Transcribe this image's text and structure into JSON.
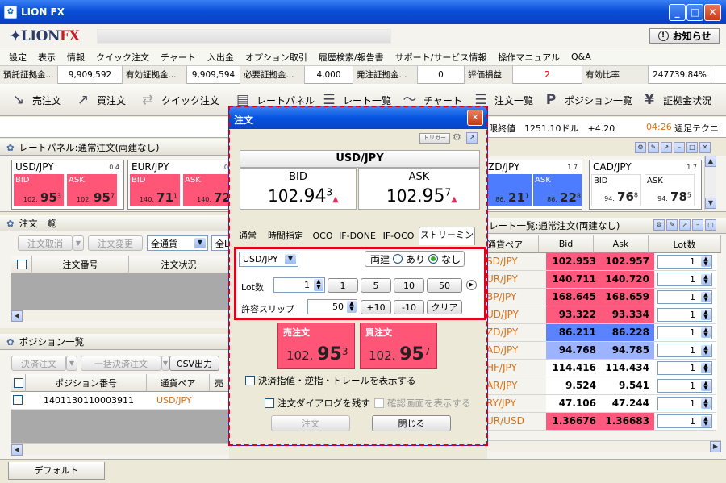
{
  "window": {
    "title": "LION FX",
    "brand_lion": "LION",
    "brand_fx": "FX",
    "notice_label": "お知らせ"
  },
  "menu": [
    "設定",
    "表示",
    "情報",
    "クイック注文",
    "チャート",
    "入出金",
    "オプション取引",
    "履歴検索/報告書",
    "サポート/サービス情報",
    "操作マニュアル",
    "Q&A"
  ],
  "account": [
    {
      "label": "預託証拠金...",
      "value": "9,909,592"
    },
    {
      "label": "有効証拠金...",
      "value": "9,909,594"
    },
    {
      "label": "必要証拠金...",
      "value": "4,000"
    },
    {
      "label": "発注証拠金...",
      "value": "0"
    },
    {
      "label": "評価損益",
      "value": "2"
    },
    {
      "label": "有効比率",
      "value": "247739.84%"
    }
  ],
  "toolbar": [
    "売注文",
    "買注文",
    "クイック注文",
    "レートパネル",
    "レート一覧",
    "チャート",
    "注文一覧",
    "ポジション一覧",
    "証拠金状況"
  ],
  "news": {
    "text": "限終値　1251.10ドル　+4.20",
    "time": "04:26",
    "headline": "週足テクニ"
  },
  "rate_panel": {
    "title": "レートパネル:通常注文(両建なし)",
    "boxes": [
      {
        "pair": "USD/JPY",
        "spread": "0.4",
        "bid_small": "102.",
        "bid_big": "95",
        "bid_sup": "3",
        "ask_small": "102.",
        "ask_big": "95",
        "ask_sup": "7"
      },
      {
        "pair": "EUR/JPY",
        "spread": "0",
        "bid_small": "140.",
        "bid_big": "71",
        "bid_sup": "1",
        "ask_small": "140.",
        "ask_big": "72",
        "ask_sup": ""
      }
    ],
    "right_boxes": [
      {
        "pair": "ZD/JPY",
        "spread": "1.7",
        "bid_small": "86.",
        "bid_big": "21",
        "bid_sup": "1",
        "ask_small": "86.",
        "ask_big": "22",
        "ask_sup": "8"
      },
      {
        "pair": "CAD/JPY",
        "spread": "1.7",
        "bid_small": "94.",
        "bid_big": "76",
        "bid_sup": "8",
        "ask_small": "94.",
        "ask_big": "78",
        "ask_sup": "5"
      }
    ],
    "bid_label": "BID",
    "ask_label": "ASK"
  },
  "order_list": {
    "title": "注文一覧",
    "btn_cancel": "注文取消",
    "btn_change": "注文変更",
    "filter": "全通貨",
    "filter2": "全L",
    "cols": [
      "注文番号",
      "注文状況"
    ]
  },
  "position_list": {
    "title": "ポジション一覧",
    "btn_settle": "決済注文",
    "btn_bulk": "一括決済注文",
    "btn_csv": "CSV出力",
    "cols": [
      "ポジション番号",
      "通貨ペア",
      "売"
    ],
    "row": {
      "id": "1401130110003911",
      "pair": "USD/JPY"
    }
  },
  "rate_list": {
    "title": "レート一覧:通常注文(両建なし)",
    "cols": [
      "通貨ペア",
      "Bid",
      "Ask",
      "Lot数"
    ],
    "rows": [
      {
        "pair": "SD/JPY",
        "bid": "102.953",
        "ask": "102.957",
        "lot": "1",
        "color": "#ff5a7e"
      },
      {
        "pair": "UR/JPY",
        "bid": "140.711",
        "ask": "140.720",
        "lot": "1",
        "color": "#ff5a7e"
      },
      {
        "pair": "BP/JPY",
        "bid": "168.645",
        "ask": "168.659",
        "lot": "1",
        "color": "#ff5a7e"
      },
      {
        "pair": "UD/JPY",
        "bid": "93.322",
        "ask": "93.334",
        "lot": "1",
        "color": "#ff5a7e"
      },
      {
        "pair": "ZD/JPY",
        "bid": "86.211",
        "ask": "86.228",
        "lot": "1",
        "color": "#5b82ff"
      },
      {
        "pair": "AD/JPY",
        "bid": "94.768",
        "ask": "94.785",
        "lot": "1",
        "color": "#9cb4ff"
      },
      {
        "pair": "HF/JPY",
        "bid": "114.416",
        "ask": "114.434",
        "lot": "1",
        "color": "#ffffff"
      },
      {
        "pair": "AR/JPY",
        "bid": "9.524",
        "ask": "9.541",
        "lot": "1",
        "color": "#ffffff"
      },
      {
        "pair": "RY/JPY",
        "bid": "47.106",
        "ask": "47.244",
        "lot": "1",
        "color": "#ffffff"
      },
      {
        "pair": "UR/USD",
        "bid": "1.36676",
        "ask": "1.36683",
        "lot": "1",
        "color": "#ff5a7e"
      }
    ]
  },
  "dialog": {
    "title": "注文",
    "trigger": "トリガー",
    "pair": "USD/JPY",
    "bid_label": "BID",
    "ask_label": "ASK",
    "bid_int": "102.",
    "bid_big": "94",
    "bid_sup": "3",
    "ask_int": "102.",
    "ask_big": "95",
    "ask_sup": "7",
    "tabs": [
      "通常",
      "時間指定",
      "OCO",
      "IF-DONE",
      "IF-OCO",
      "ストリーミング"
    ],
    "select_pair": "USD/JPY",
    "hedge_label": "両建",
    "hedge_yes": "あり",
    "hedge_no": "なし",
    "lot_label": "Lot数",
    "lot_value": "1",
    "lot_presets": [
      "1",
      "5",
      "10",
      "50"
    ],
    "slip_label": "許容スリップ",
    "slip_value": "50",
    "slip_plus": "+10",
    "slip_minus": "-10",
    "clear": "クリア",
    "sell_label": "売注文",
    "buy_label": "買注文",
    "sell_int": "102.",
    "sell_big": "95",
    "sell_sup": "3",
    "buy_int": "102.",
    "buy_big": "95",
    "buy_sup": "7",
    "chk_show": "決済指値・逆指・トレールを表示する",
    "chk_keep": "注文ダイアログを残す",
    "chk_confirm": "確認画面を表示する",
    "btn_order": "注文",
    "btn_close": "閉じる"
  },
  "statusbar": {
    "tab": "デフォルト"
  }
}
